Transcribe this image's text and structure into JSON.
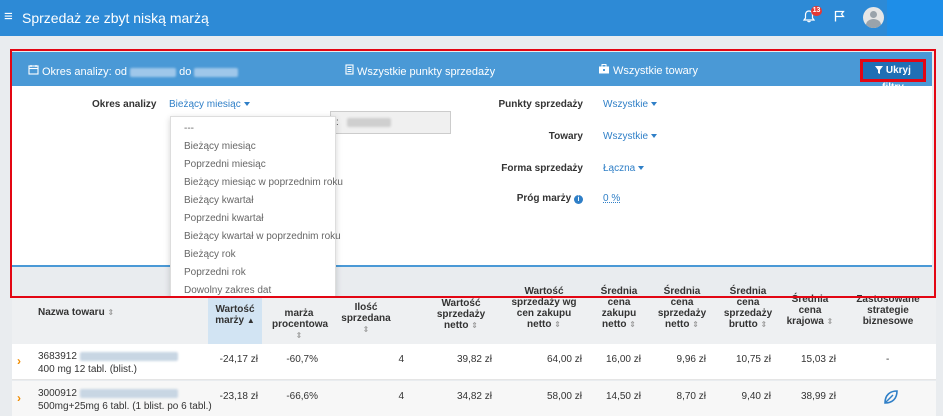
{
  "header": {
    "title": "Sprzedaż ze zbyt niską marżą",
    "menu_icon": "≡",
    "notification_count": "13",
    "accent_color": "#2d8ad6"
  },
  "filter_header": {
    "period_label": "Okres analizy: od",
    "period_to": "do",
    "points_label": "Wszystkie punkty sprzedaży",
    "goods_label": "Wszystkie towary",
    "hide_filters": "Ukryj filtry"
  },
  "filters": {
    "period_label": "Okres analizy",
    "period_value": "Bieżący miesiąc",
    "date_colon": ":",
    "points_label": "Punkty sprzedaży",
    "points_value": "Wszystkie",
    "goods_label": "Towary",
    "goods_value": "Wszystkie",
    "sale_form_label": "Forma sprzedaży",
    "sale_form_value": "Łączna",
    "margin_threshold_label": "Próg marży",
    "margin_threshold_value": "0 %"
  },
  "dropdown": {
    "items": [
      "---",
      "Bieżący miesiąc",
      "Poprzedni miesiąc",
      "Bieżący miesiąc w poprzednim roku",
      "Bieżący kwartał",
      "Poprzedni kwartał",
      "Bieżący kwartał w poprzednim roku",
      "Bieżący rok",
      "Poprzedni rok",
      "Dowolny zakres dat"
    ]
  },
  "table": {
    "columns": [
      "Nazwa towaru",
      "Wartość marży",
      "marża procentowa",
      "Ilość sprzedana",
      "Wartość sprzedaży netto",
      "Wartość sprzedaży wg cen zakupu netto",
      "Średnia cena zakupu netto",
      "Średnia cena sprzedaży netto",
      "Średnia cena sprzedaży brutto",
      "Średnia cena krajowa",
      "Zastosowane strategie biznesowe"
    ],
    "rows": [
      {
        "code": "3683912",
        "desc": "400 mg 12 tabl. (blist.)",
        "margin_value": "-24,17 zł",
        "margin_pct": "-60,7%",
        "qty": "4",
        "sales_net": "39,82 zł",
        "sales_purchase": "64,00 zł",
        "avg_purchase": "16,00 zł",
        "avg_sale_net": "9,96 zł",
        "avg_sale_gross": "10,75 zł",
        "avg_national": "15,03 zł",
        "strategy": "-"
      },
      {
        "code": "3000912",
        "desc": "500mg+25mg 6 tabl. (1 blist. po 6 tabl.)",
        "margin_value": "-23,18 zł",
        "margin_pct": "-66,6%",
        "qty": "4",
        "sales_net": "34,82 zł",
        "sales_purchase": "58,00 zł",
        "avg_purchase": "14,50 zł",
        "avg_sale_net": "8,70 zł",
        "avg_sale_gross": "9,40 zł",
        "avg_national": "38,99 zł",
        "strategy": ""
      }
    ]
  }
}
